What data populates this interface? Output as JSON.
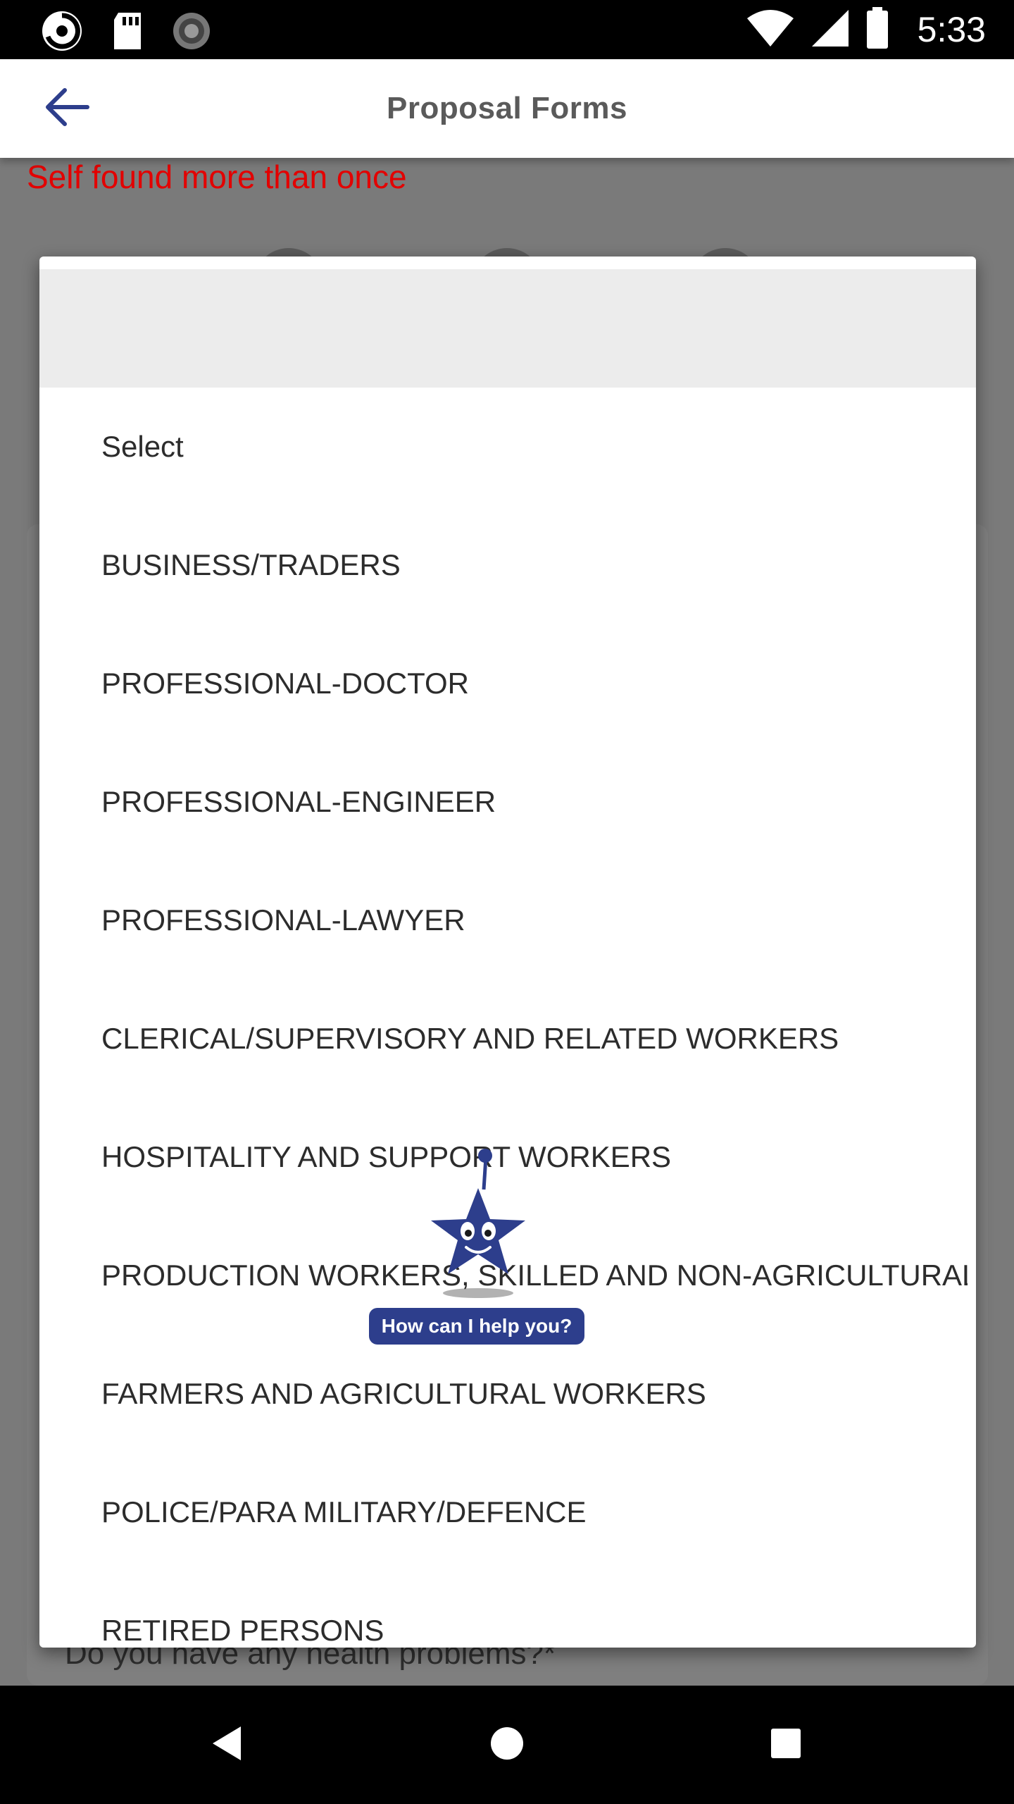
{
  "status_bar": {
    "time": "5:33",
    "left_icons": [
      "sync-app-icon",
      "sd-card-icon",
      "loading-icon"
    ],
    "right_icons": [
      "wifi-icon",
      "cell-signal-icon",
      "battery-icon"
    ]
  },
  "app_bar": {
    "title": "Proposal Forms",
    "back_icon": "arrow-left-icon"
  },
  "page": {
    "error_message": "Self found more than once",
    "health_question": "Do you have any health problems?*"
  },
  "dropdown": {
    "options": [
      "Select",
      "BUSINESS/TRADERS",
      "PROFESSIONAL-DOCTOR",
      "PROFESSIONAL-ENGINEER",
      "PROFESSIONAL-LAWYER",
      "CLERICAL/SUPERVISORY AND RELATED WORKERS",
      "HOSPITALITY AND SUPPORT WORKERS",
      "PRODUCTION WORKERS, SKILLED AND NON-AGRICULTURAL",
      "FARMERS AND AGRICULTURAL WORKERS",
      "POLICE/PARA MILITARY/DEFENCE",
      "RETIRED PERSONS"
    ]
  },
  "chatbot": {
    "label": "How can I help you?",
    "icon": "star-mascot-icon"
  },
  "nav_bar": {
    "icons": [
      "back-triangle-icon",
      "home-circle-icon",
      "recents-square-icon"
    ]
  },
  "colors": {
    "accent": "#2d3e8c",
    "error": "#e30000",
    "scrim": "#7a7a7a"
  }
}
